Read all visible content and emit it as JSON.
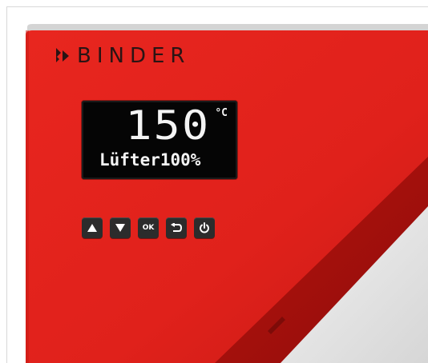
{
  "brand": {
    "name": "BINDER",
    "logo_icon": "binder-chevron-logo"
  },
  "display": {
    "temperature": "150",
    "unit": "°C",
    "status_text": "Lüfter100%"
  },
  "keypad": {
    "up_icon": "arrow-up-icon",
    "down_icon": "arrow-down-icon",
    "ok_label": "OK",
    "back_icon": "return-icon",
    "power_icon": "power-icon"
  },
  "colors": {
    "panel_red": "#e2231d",
    "display_bg": "#050505",
    "key_bg": "#2c2c2c"
  }
}
